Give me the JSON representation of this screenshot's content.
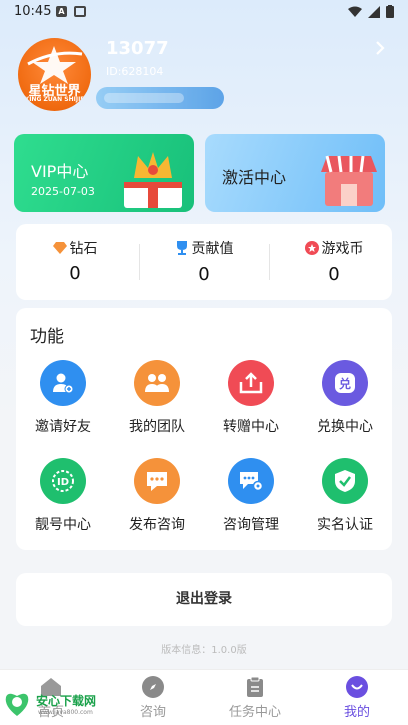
{
  "status": {
    "time": "10:45"
  },
  "profile": {
    "name": "13077",
    "id_text": "ID:628104",
    "avatar_text": "星钻世界",
    "avatar_sub": "XING ZUAN SHIJIE"
  },
  "cards": {
    "vip": {
      "title": "VIP中心",
      "date": "2025-07-03"
    },
    "activate": {
      "title": "激活中心"
    }
  },
  "stats": [
    {
      "label": "钻石",
      "value": "0",
      "icon": "diamond-icon"
    },
    {
      "label": "贡献值",
      "value": "0",
      "icon": "trophy-icon"
    },
    {
      "label": "游戏币",
      "value": "0",
      "icon": "coin-icon"
    }
  ],
  "functions": {
    "title": "功能",
    "items": [
      {
        "label": "邀请好友",
        "icon": "invite-user-icon",
        "color": "#2f8ff0"
      },
      {
        "label": "我的团队",
        "icon": "team-icon",
        "color": "#f5923a"
      },
      {
        "label": "转赠中心",
        "icon": "transfer-icon",
        "color": "#f04b55"
      },
      {
        "label": "兑换中心",
        "icon": "exchange-icon",
        "color": "#6a5ae0"
      },
      {
        "label": "靓号中心",
        "icon": "id-number-icon",
        "color": "#1fbf6e"
      },
      {
        "label": "发布咨询",
        "icon": "message-icon",
        "color": "#f5923a"
      },
      {
        "label": "咨询管理",
        "icon": "chat-settings-icon",
        "color": "#2f8ff0"
      },
      {
        "label": "实名认证",
        "icon": "verified-shield-icon",
        "color": "#1fbf6e"
      }
    ]
  },
  "logout_label": "退出登录",
  "version": "版本信息：1.0.0版",
  "tabs": [
    {
      "label": "首页",
      "icon": "home-icon",
      "active": false
    },
    {
      "label": "咨询",
      "icon": "compass-icon",
      "active": false
    },
    {
      "label": "任务中心",
      "icon": "clipboard-icon",
      "active": false
    },
    {
      "label": "我的",
      "icon": "profile-icon",
      "active": true
    }
  ],
  "watermark": {
    "text": "安心下载网",
    "sub": "www.java800.com"
  }
}
